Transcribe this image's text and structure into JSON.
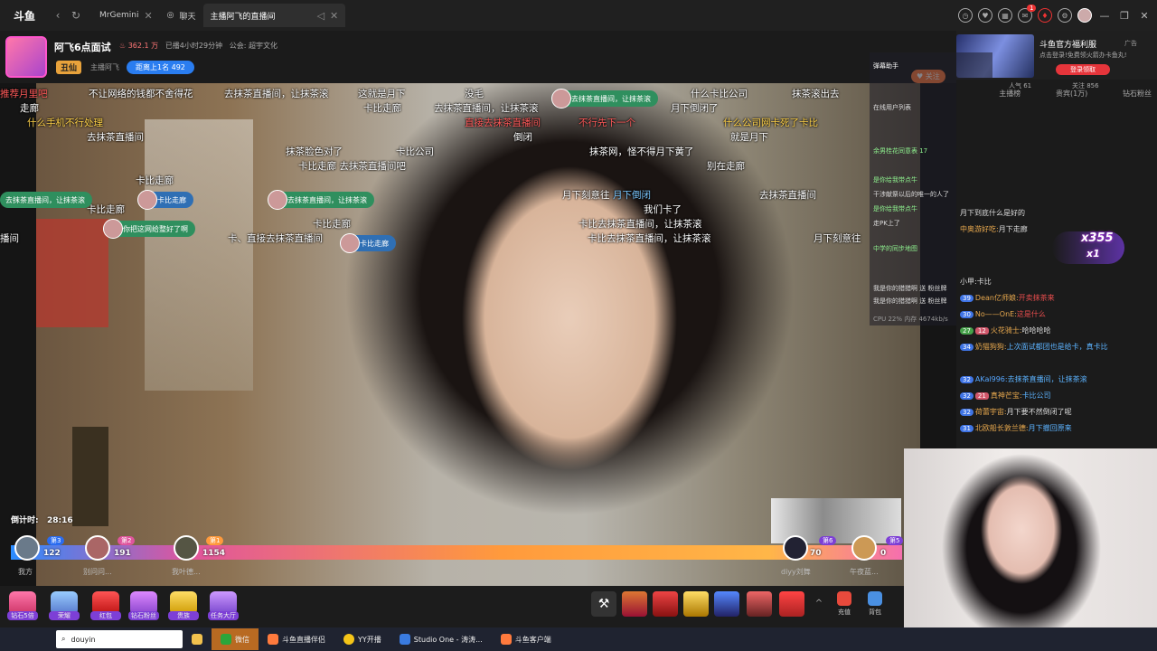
{
  "browser": {
    "logo": "斗鱼",
    "tabs": [
      {
        "label": "MrGemini",
        "active": false
      },
      {
        "label": "聊天",
        "active": false
      },
      {
        "label": "主播阿飞的直播间",
        "active": true
      }
    ],
    "notif_count": "1"
  },
  "room": {
    "title": "阿飞6点面试",
    "hot": "362.1 万",
    "live_time": "已播4小时29分钟",
    "notice": "公会: 超宇文化",
    "tag": "丑仙",
    "anchor_label": "主播阿飞",
    "rank": "距离上1名 492",
    "follow": "关注"
  },
  "ad": {
    "title": "斗鱼官方福利服",
    "label": "广告",
    "desc": "点击登录!免费领火箭办卡鱼丸!",
    "button": "登录领取"
  },
  "danmaku": [
    {
      "text": "不让网络的钱都不舍得花",
      "c": ""
    },
    {
      "text": "去抹茶直播间，让抹茶滚",
      "c": ""
    },
    {
      "text": "这就是月下",
      "c": ""
    },
    {
      "text": "没毛",
      "c": ""
    },
    {
      "text": "什么卡比公司",
      "c": ""
    },
    {
      "text": "抹茶滚出去",
      "c": ""
    },
    {
      "text": "走廊",
      "c": ""
    },
    {
      "text": "去抹茶直播间，让抹茶滚",
      "c": ""
    },
    {
      "text": "卡比走廊",
      "c": ""
    },
    {
      "text": "去抹茶直播间",
      "c": ""
    },
    {
      "text": "卡比公司",
      "c": ""
    },
    {
      "text": "倒闭",
      "c": ""
    },
    {
      "text": "卡比走廊 去抹茶直播间吧",
      "c": ""
    },
    {
      "text": "我们卡了",
      "c": ""
    },
    {
      "text": "卡比走廊",
      "c": ""
    },
    {
      "text": "月下倒闭了",
      "c": ""
    },
    {
      "text": "直接去抹茶直播间",
      "c": "r"
    },
    {
      "text": "不行先下一个",
      "c": "r"
    },
    {
      "text": "什么公司网卡死了卡比",
      "c": "y"
    },
    {
      "text": "卡比去抹茶直播间，让抹茶滚",
      "c": ""
    },
    {
      "text": "月下刻意往",
      "c": ""
    },
    {
      "text": "卡比公司",
      "c": "b"
    },
    {
      "text": "抹茶脸色对了",
      "c": ""
    },
    {
      "text": "就是月下",
      "c": ""
    },
    {
      "text": "倒闭",
      "c": ""
    }
  ],
  "gifts_overlay": [
    {
      "text": "去抹茶直播间，让抹茶滚"
    },
    {
      "text": "卡比走廊"
    },
    {
      "text": "去抹茶直播间，让抹茶滚"
    },
    {
      "text": "你把这网给整好了啊"
    },
    {
      "text": "卡比走廊"
    },
    {
      "text": "去抹茶直播间，让抹茶滚"
    }
  ],
  "pk": {
    "countdown_label": "倒计时:",
    "countdown": "28:16",
    "left": [
      {
        "rank": "第3",
        "score": "122",
        "name": "我方"
      },
      {
        "rank": "第2",
        "score": "191",
        "name": "别问问..."
      },
      {
        "rank": "第1",
        "score": "1154",
        "name": "我叶德..."
      }
    ],
    "right": [
      {
        "rank": "第6",
        "score": "70",
        "name": "diyy刘舞"
      },
      {
        "rank": "第5",
        "score": "0",
        "name": "午夜蓝..."
      }
    ]
  },
  "toolbar": {
    "items": [
      {
        "label": "钻石5倍"
      },
      {
        "label": "荣耀"
      },
      {
        "label": "红包"
      },
      {
        "label": "钻石粉丝"
      },
      {
        "label": "贵族"
      },
      {
        "label": "任务大厅"
      }
    ],
    "charge": "充值",
    "backpack": "背包"
  },
  "chat": {
    "tabs": [
      "主播榜",
      "贵宾(1万)",
      "钻石粉丝"
    ],
    "stats": {
      "fans": "人气 61",
      "follow": "关注 856"
    },
    "lines": [
      {
        "lv": "",
        "fan": "",
        "user": "",
        "msg": "月下到底什么是好的"
      },
      {
        "lv": "",
        "fan": "",
        "user": "中奥游好吃:",
        "msg": "月下走廊"
      },
      {
        "lv": "",
        "fan": "",
        "user": "",
        "msg": "卡比"
      },
      {
        "lv": "",
        "fan": "",
        "user": "",
        "msg": "小甲:卡比"
      },
      {
        "lv": "39",
        "fan": "",
        "user": "Dean亿师娘:",
        "msg": "开卖抹茶来"
      },
      {
        "lv": "30",
        "fan": "",
        "user": "No——OnE:",
        "msg": "这是什么"
      },
      {
        "lv": "27",
        "fan": "12",
        "user": "火花骑士:",
        "msg": "哈哈哈哈"
      },
      {
        "lv": "34",
        "fan": "",
        "user": "奶猫狗狗:",
        "msg": "上次面试都团也是给卡，真卡比"
      },
      {
        "lv": "32",
        "fan": "",
        "user": "AKal996:",
        "msg": "去抹茶直播间，让抹茶滚"
      },
      {
        "lv": "32",
        "fan": "21",
        "user": "真神芒宝:",
        "msg": "卡比公司"
      },
      {
        "lv": "32",
        "fan": "",
        "user": "荷蕾宇宙:",
        "msg": "月下要不然倒闭了呢"
      },
      {
        "lv": "31",
        "fan": "",
        "user": "北欧船长敦兰德:",
        "msg": "月下撤回原来"
      }
    ]
  },
  "overlay": {
    "lines": [
      "弹幕助手",
      "在线用户列表",
      "余男桂花同意表 17",
      "是你给我带点牛",
      "干涉献祭以后的唯一的人了",
      "是你给我带点牛",
      "走PK上了",
      "中学的同步地图",
      "我是你的猎猎啊 送 粉丝牌",
      "我是你的猎猎啊 送 粉丝牌",
      "CPU 22% 内存 4674kb/s"
    ]
  },
  "gift_combo": {
    "count": "x355",
    "mult": "x1"
  },
  "taskbar": {
    "search": "douyin",
    "apps": [
      {
        "label": "微信",
        "color": "#2aa63a",
        "active": true
      },
      {
        "label": "斗鱼直播伴侣",
        "color": "#ff7a3d",
        "active": false
      },
      {
        "label": "YY开播",
        "color": "#f5c518",
        "active": false
      },
      {
        "label": "Studio One - 涛涛...",
        "color": "#3a7be0",
        "active": false
      },
      {
        "label": "斗鱼客户端",
        "color": "#ff7a3d",
        "active": false
      }
    ]
  }
}
